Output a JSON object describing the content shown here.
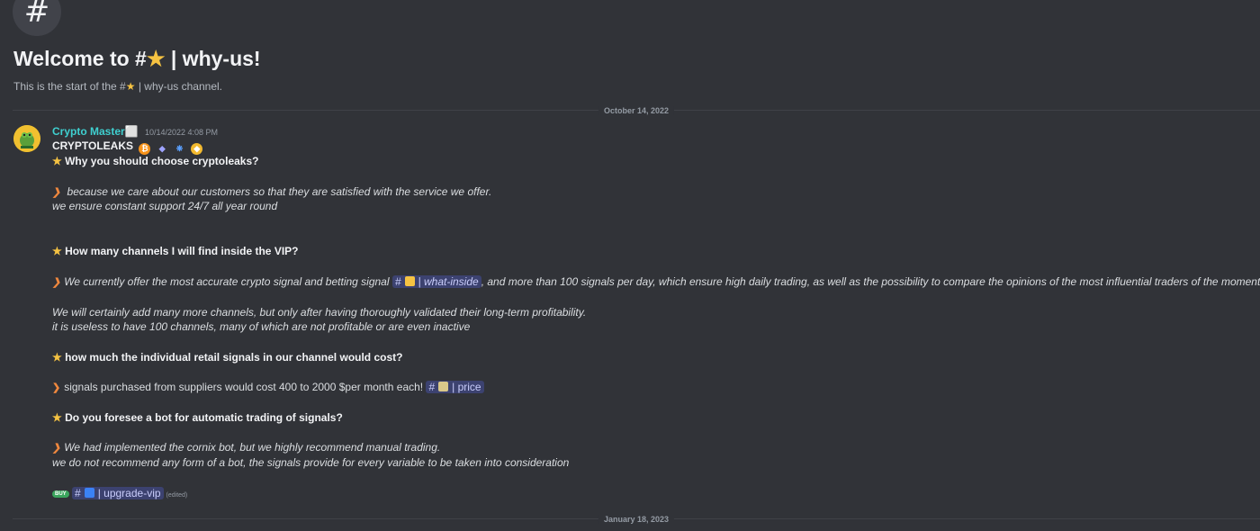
{
  "channel_header": {
    "hash_icon": "#",
    "welcome_prefix": "Welcome to #",
    "welcome_suffix": " | why-us!",
    "start_prefix": "This is the start of the #",
    "start_suffix": " | why-us channel."
  },
  "dividers": {
    "first": "October 14, 2022",
    "second": "January 18, 2023"
  },
  "message": {
    "author": "Crypto Master⬜",
    "timestamp": "10/14/2022 4:08 PM",
    "title": "CRYPTOLEAKS",
    "q1": "Why you should choose cryptoleaks?",
    "a1_line1": " because we care about our customers so that they are satisfied with the service we offer.",
    "a1_line2": "we ensure constant support 24/7 all year round",
    "q2": "How many channels I will find inside the VIP?",
    "a2_part1": "We currently offer the most accurate crypto signal and betting signal ",
    "a2_mention": "| what-inside",
    "a2_part2": ", and more than 100 signals per day, which ensure high daily trading, as well as the possibility to compare the opinions of the most influential traders of the moment",
    "a2_line2": "We will certainly add many more channels, but only after having thoroughly validated their long-term profitability.",
    "a2_line3": "it is useless to have 100 channels, many of which are not profitable or are even inactive",
    "q3": " how much the individual retail signals in our channel would cost?",
    "a3_text": "signals purchased from suppliers would cost 400 to 2000 $per month each! ",
    "a3_mention": "| price",
    "q4": "Do you foresee a bot for automatic trading of signals?",
    "a4_line1": "We had implemented the cornix bot, but we highly recommend manual trading.",
    "a4_line2": "we do not recommend any form of a bot, the signals provide for every variable to be taken into consideration",
    "buy_badge": "BUY",
    "final_mention": "| upgrade-vip",
    "edited": "(edited)"
  },
  "icons": {
    "star": "★",
    "arrow": "❯",
    "hash": "#"
  },
  "colors": {
    "background": "#313338",
    "username": "#3fd0d0",
    "mention_bg": "#3c4270",
    "star": "#f6c342",
    "arrow": "#f0883e"
  }
}
